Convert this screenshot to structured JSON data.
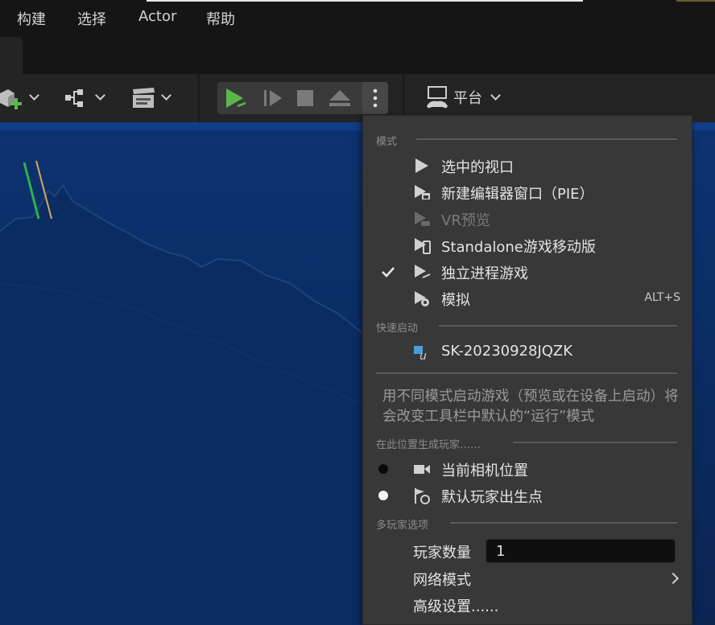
{
  "menu": {
    "items": [
      "构建",
      "选择",
      "Actor",
      "帮助"
    ]
  },
  "toolbar": {
    "platform_label": "平台"
  },
  "dropdown": {
    "mode_header": "模式",
    "modes": [
      {
        "label": "选中的视口",
        "icon": "play-icon",
        "checked": false,
        "enabled": true,
        "shortcut": ""
      },
      {
        "label": "新建编辑器窗口（PIE）",
        "icon": "play-window-icon",
        "checked": false,
        "enabled": true,
        "shortcut": ""
      },
      {
        "label": "VR预览",
        "icon": "play-vr-icon",
        "checked": false,
        "enabled": false,
        "shortcut": ""
      },
      {
        "label": "Standalone游戏移动版",
        "icon": "play-mobile-icon",
        "checked": false,
        "enabled": true,
        "shortcut": ""
      },
      {
        "label": "独立进程游戏",
        "icon": "play-standalone-icon",
        "checked": true,
        "enabled": true,
        "shortcut": ""
      },
      {
        "label": "模拟",
        "icon": "simulate-icon",
        "checked": false,
        "enabled": true,
        "shortcut": "ALT+S"
      }
    ],
    "quick_launch_header": "快速启动",
    "quick_launch_device": "SK-20230928JQZK",
    "info_text": "用不同模式启动游戏（预览或在设备上启动）将会改变工具栏中默认的“运行”模式",
    "spawn_header": "在此位置生成玩家……",
    "spawn_options": [
      {
        "label": "当前相机位置",
        "selected": false
      },
      {
        "label": "默认玩家出生点",
        "selected": true
      }
    ],
    "multiplayer_header": "多玩家选项",
    "player_count_label": "玩家数量",
    "player_count_value": "1",
    "net_mode_label": "网络模式",
    "advanced_label": "高级设置......"
  },
  "colors": {
    "play_green": "#5ab84a",
    "viewport_blue": "#0b2f69",
    "menu_bg": "#383838"
  }
}
